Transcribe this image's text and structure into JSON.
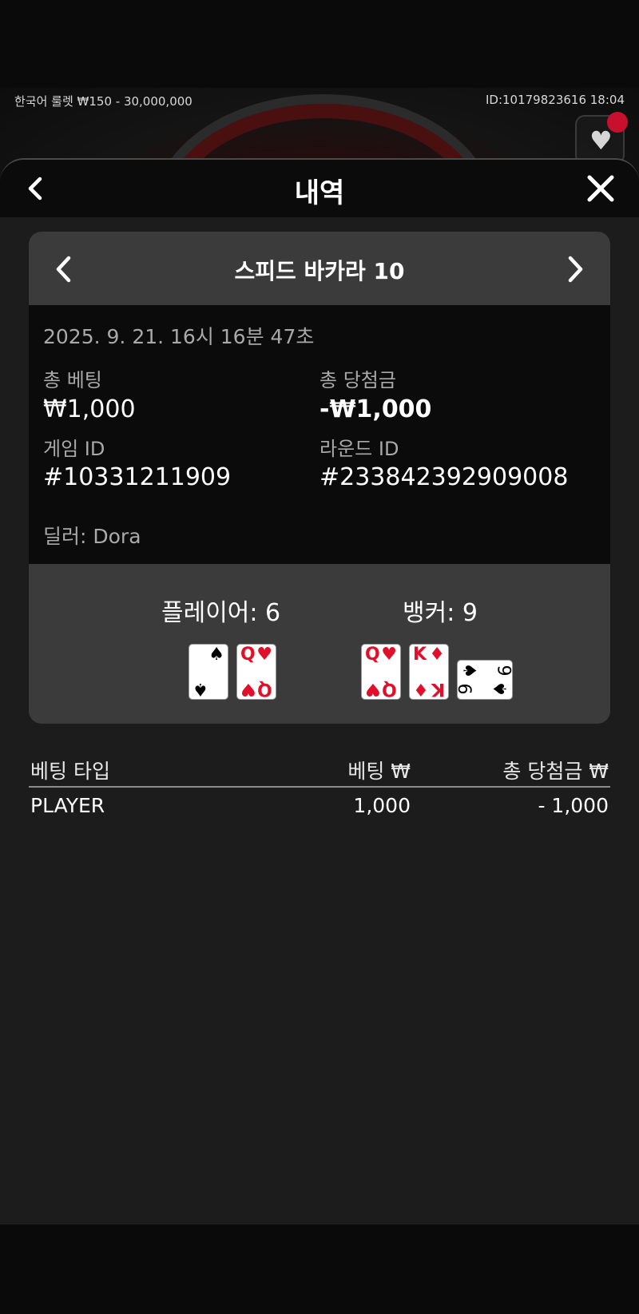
{
  "topbar": {
    "left_info": "한국어 룰렛  ₩150 - 30,000,000",
    "right_info": "ID:10179823616  18:04"
  },
  "sheet": {
    "title": "내역"
  },
  "game": {
    "name": "스피드 바카라 10",
    "datetime": "2025. 9. 21. 16시 16분 47초",
    "total_bet_label": "총 베팅",
    "total_bet_value": "₩1,000",
    "total_win_label": "총 당첨금",
    "total_win_value": "-₩1,000",
    "game_id_label": "게임 ID",
    "game_id_value": "#10331211909",
    "round_id_label": "라운드 ID",
    "round_id_value": "#233842392909008",
    "dealer": "딜러: Dora"
  },
  "result": {
    "player_label": "플레이어: 6",
    "banker_label": "뱅커: 9",
    "player_cards": [
      {
        "rank": "6",
        "suit": "♠",
        "color": "#000000"
      },
      {
        "rank": "Q",
        "suit": "♥",
        "color": "#e0102a"
      }
    ],
    "banker_cards": [
      {
        "rank": "Q",
        "suit": "♥",
        "color": "#e0102a"
      },
      {
        "rank": "K",
        "suit": "♦",
        "color": "#e0102a"
      },
      {
        "rank": "9",
        "suit": "♠",
        "color": "#000000"
      }
    ]
  },
  "bets_table": {
    "headers": [
      "베팅 타입",
      "베팅 ₩",
      "총 당첨금 ₩"
    ],
    "rows": [
      [
        "PLAYER",
        "1,000",
        "- 1,000"
      ]
    ]
  }
}
